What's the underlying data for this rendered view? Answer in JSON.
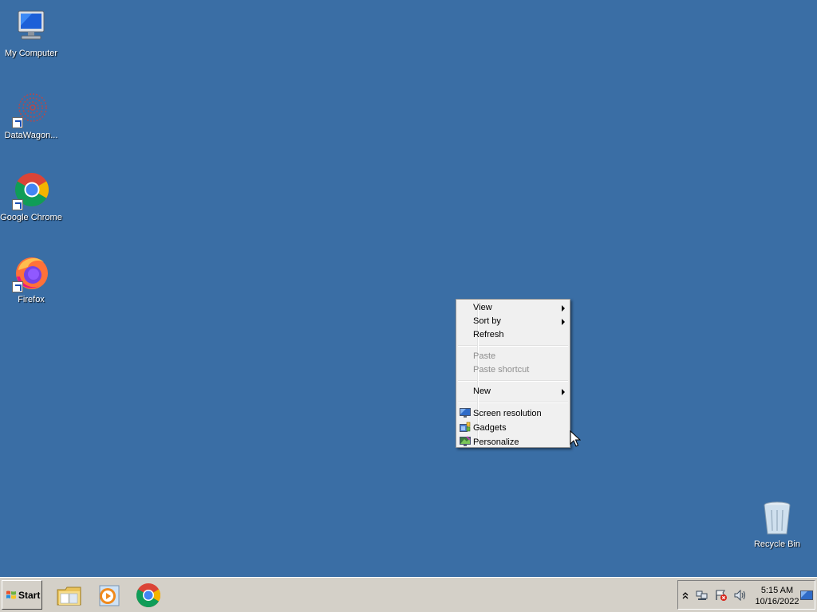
{
  "desktop": {
    "background_color": "#3a6ea5",
    "icons": [
      {
        "label": "My Computer",
        "icon": "computer-icon",
        "shortcut": false
      },
      {
        "label": "DataWagon...",
        "icon": "datawagon-icon",
        "shortcut": true
      },
      {
        "label": "Google Chrome",
        "icon": "chrome-icon",
        "shortcut": true
      },
      {
        "label": "Firefox",
        "icon": "firefox-icon",
        "shortcut": true
      },
      {
        "label": "Recycle Bin",
        "icon": "recycle-bin-icon",
        "shortcut": false
      }
    ]
  },
  "context_menu": {
    "items": [
      {
        "label": "View",
        "submenu": true,
        "enabled": true
      },
      {
        "label": "Sort by",
        "submenu": true,
        "enabled": true
      },
      {
        "label": "Refresh",
        "submenu": false,
        "enabled": true
      },
      {
        "label": "Paste",
        "submenu": false,
        "enabled": false
      },
      {
        "label": "Paste shortcut",
        "submenu": false,
        "enabled": false
      },
      {
        "label": "New",
        "submenu": true,
        "enabled": true
      },
      {
        "label": "Screen resolution",
        "icon": "screen-resolution-icon",
        "enabled": true
      },
      {
        "label": "Gadgets",
        "icon": "gadgets-icon",
        "enabled": true
      },
      {
        "label": "Personalize",
        "icon": "personalize-icon",
        "enabled": true
      }
    ]
  },
  "taskbar": {
    "start_label": "Start",
    "pinned": [
      "file-explorer-icon",
      "media-player-icon",
      "chrome-icon"
    ],
    "tray_icons": [
      "show-hidden-icons-chevron",
      "network-icon",
      "action-center-icon",
      "volume-icon"
    ],
    "clock": {
      "time": "5:15 AM",
      "date": "10/16/2022"
    }
  }
}
